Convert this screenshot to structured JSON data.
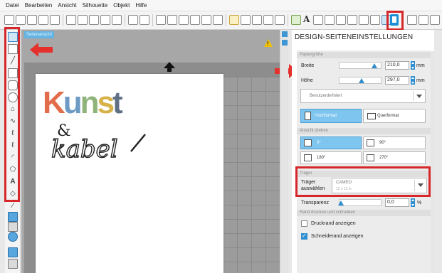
{
  "menu": [
    "Datei",
    "Bearbeiten",
    "Ansicht",
    "Silhouette",
    "Objekt",
    "Hilfe"
  ],
  "canvas": {
    "tab_label": "Seitenansicht",
    "artwork_title": [
      "K",
      "u",
      "n",
      "s",
      "t"
    ],
    "artwork_title_colors": [
      "#e26d4b",
      "#6d9bc4",
      "#8fb47a",
      "#d7b24a",
      "#5f6f86"
    ],
    "artwork_ampersand": "&",
    "artwork_script": "kabel"
  },
  "panel": {
    "title": "DESIGN-SEITENEINSTELLUNGEN",
    "section_paper": "Papiergröße",
    "width_label": "Breite",
    "width_value": "210,0",
    "width_unit": "mm",
    "height_label": "Höhe",
    "height_value": "297,0",
    "height_unit": "mm",
    "paper_preset": "Benutzerdefiniert",
    "portrait_label": "Hochformat",
    "landscape_label": "Querformat",
    "section_rotate": "Ansicht drehen",
    "rotations": [
      "0°",
      "90°",
      "180°",
      "270°"
    ],
    "section_carrier": "Träger",
    "carrier_label_1": "Träger",
    "carrier_label_2": "auswählen",
    "carrier_value": "CAMEO",
    "carrier_sub": "12 x 12 in",
    "transparency_label": "Transparenz",
    "transparency_value": "0,0",
    "transparency_unit": "%",
    "section_print": "Rand drucken und schneiden",
    "print_border_label": "Druckrand anzeigen",
    "print_border_checked": false,
    "cut_border_label": "Schneiderand anzeigen",
    "cut_border_checked": true
  },
  "colors": {
    "accent": "#2f8fd0",
    "highlight": "#d6282a"
  }
}
